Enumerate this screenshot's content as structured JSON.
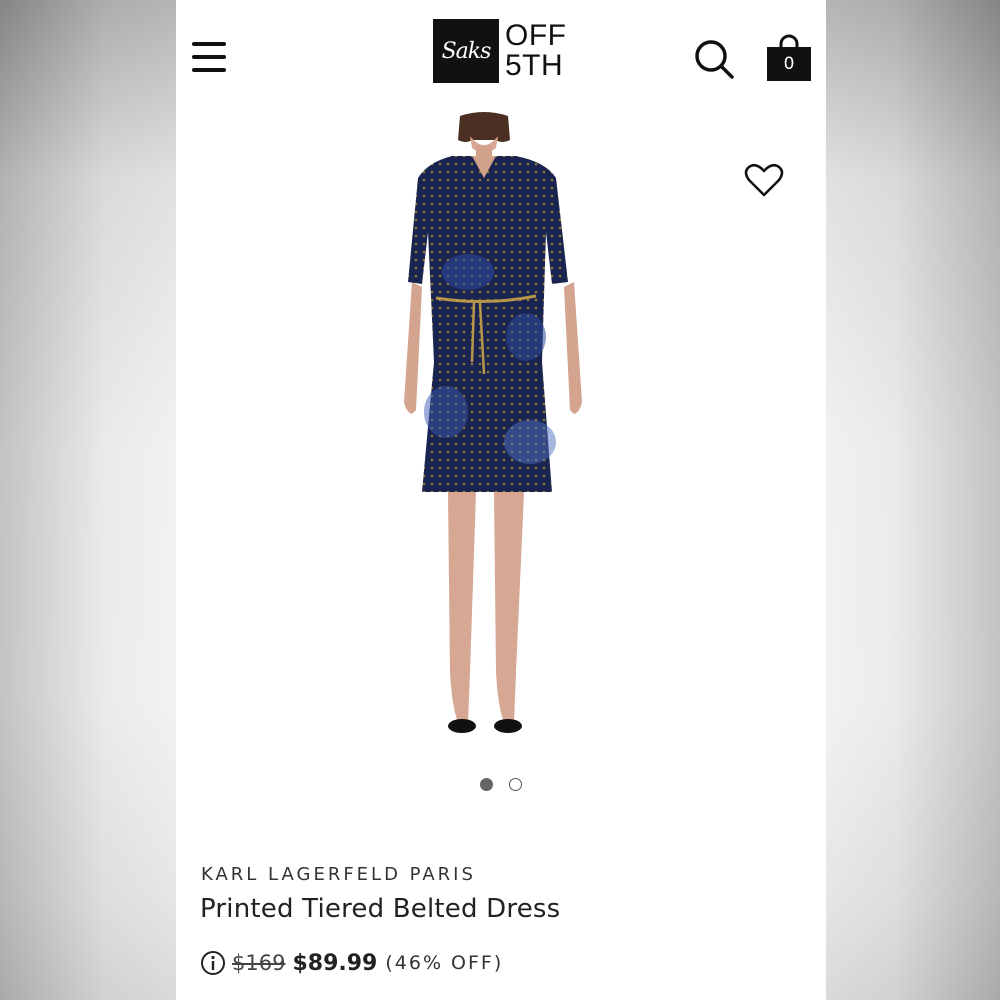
{
  "header": {
    "logo_mark": "Saks",
    "logo_line1": "OFF",
    "logo_line2": "5TH",
    "bag_count": "0",
    "icons": [
      "menu-icon",
      "search-icon",
      "shopping-bag-icon"
    ]
  },
  "gallery": {
    "image_count": 2,
    "active_index": 0,
    "wishlist_icon": "heart-icon"
  },
  "product": {
    "brand": "KARL LAGERFELD PARIS",
    "name": "Printed Tiered Belted Dress",
    "original_price": "$169",
    "sale_price": "$89.99",
    "discount": "(46% OFF)"
  },
  "colors": {
    "text": "#222222",
    "logo_bg": "#111111",
    "dress_navy": "#1c2a55",
    "dress_blue": "#2d4a9a"
  }
}
